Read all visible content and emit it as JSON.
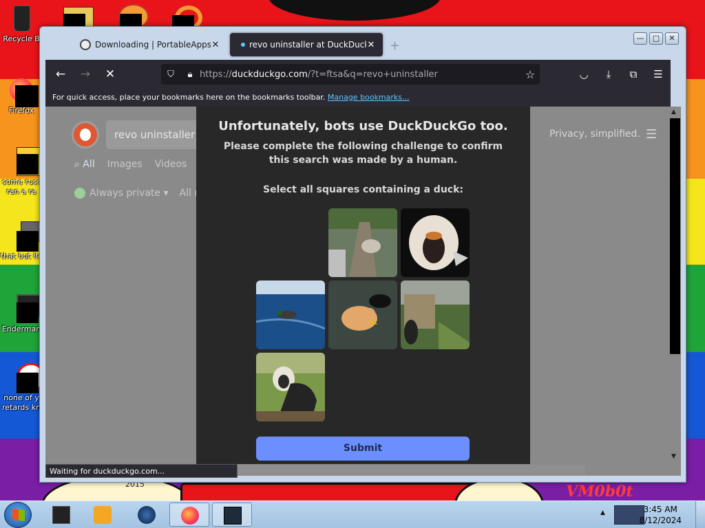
{
  "desktop": {
    "icons": [
      {
        "label": "Recycle B",
        "name": "recycle-bin"
      },
      {
        "label": "Firefox",
        "name": "firefox"
      },
      {
        "label": "some russ\nran a ra",
        "name": "file-1"
      },
      {
        "label": "that but its",
        "name": "file-2"
      },
      {
        "label": "Enderman",
        "name": "enderman"
      },
      {
        "label": "none of y\nretards kn",
        "name": "file-3"
      }
    ],
    "wallpaper_text": "VM0b0t",
    "wallpaper_year": "2015"
  },
  "browser": {
    "tabs": [
      {
        "title": "Downloading | PortableApps.co",
        "active": false
      },
      {
        "title": "revo uninstaller at DuckDuckGo",
        "active": true
      }
    ],
    "new_tab": "+",
    "window_controls": {
      "minimize": "—",
      "maximize": "□",
      "close": "✕"
    },
    "url": {
      "prefix": "https://",
      "domain": "duckduckgo.com",
      "rest": "/?t=ftsa&q=revo+uninstaller"
    },
    "bookmarks_bar": {
      "text": "For quick access, place your bookmarks here on the bookmarks toolbar.",
      "link": "Manage bookmarks..."
    },
    "status": "Waiting for duckduckgo.com..."
  },
  "ddg": {
    "search_query": "revo uninstaller",
    "tabs": [
      "All",
      "Images",
      "Videos"
    ],
    "filter": "Always private",
    "filter2": "All re",
    "tagline": "Privacy, simplified."
  },
  "captcha": {
    "heading": "Unfortunately, bots use DuckDuckGo too.",
    "description": "Please complete the following challenge to confirm this search was made by a human.",
    "instruction": "Select all squares containing a duck:",
    "submit": "Submit",
    "tiles": [
      {
        "name": "tile-monkey-tree",
        "subject": "monkey in tree"
      },
      {
        "name": "tile-monkey-face",
        "subject": "monkey face"
      },
      {
        "name": "tile-duck-water",
        "subject": "duck on water"
      },
      {
        "name": "tile-ducks-pond",
        "subject": "ducks in pond"
      },
      {
        "name": "tile-bird-cage",
        "subject": "bird near cage"
      },
      {
        "name": "tile-monkey-walking",
        "subject": "monkey walking"
      }
    ]
  },
  "taskbar": {
    "time": "3:45 AM",
    "date": "8/12/2024"
  },
  "colors": {
    "browser_chrome": "#2b2a33",
    "captcha_bg": "#282828",
    "submit_bg": "#6b8fff",
    "link": "#5ec5ff"
  }
}
